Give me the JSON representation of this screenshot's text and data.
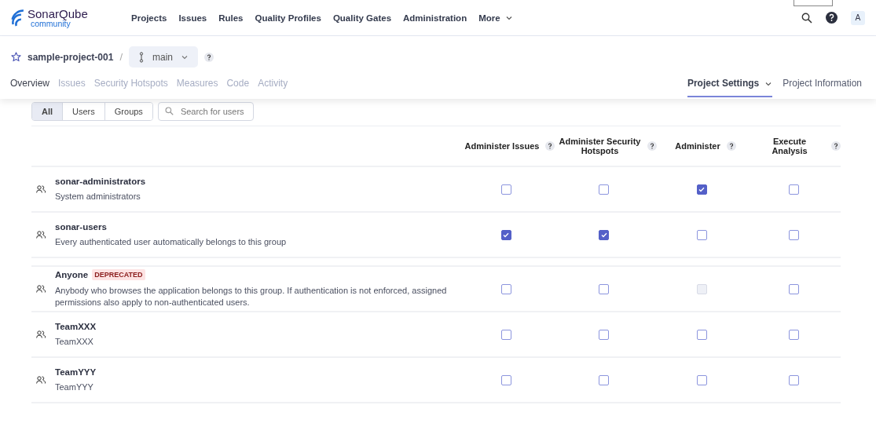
{
  "logo": {
    "name": "SonarQube",
    "edition": "community"
  },
  "nav": [
    {
      "label": "Projects"
    },
    {
      "label": "Issues"
    },
    {
      "label": "Rules"
    },
    {
      "label": "Quality Profiles"
    },
    {
      "label": "Quality Gates"
    },
    {
      "label": "Administration"
    },
    {
      "label": "More",
      "kind": "menu"
    }
  ],
  "user": {
    "initial": "A"
  },
  "breadcrumb": {
    "project": "sample-project-001",
    "separator": "/",
    "branch": "main"
  },
  "project_tabs": [
    {
      "label": "Overview",
      "disabled": false
    },
    {
      "label": "Issues",
      "disabled": true
    },
    {
      "label": "Security Hotspots",
      "disabled": true
    },
    {
      "label": "Measures",
      "disabled": true
    },
    {
      "label": "Code",
      "disabled": true
    },
    {
      "label": "Activity",
      "disabled": true
    }
  ],
  "project_menus": [
    {
      "label": "Project Settings",
      "selected": true,
      "kind": "menu"
    },
    {
      "label": "Project Information",
      "selected": false,
      "kind": "link"
    }
  ],
  "filter": {
    "options": [
      {
        "label": "All",
        "selected": true
      },
      {
        "label": "Users",
        "selected": false
      },
      {
        "label": "Groups",
        "selected": false
      }
    ],
    "search": {
      "placeholder": "Search for users"
    }
  },
  "table": {
    "columns": [
      "Administer Issues",
      "Administer Security Hotspots",
      "Administer",
      "Execute Analysis"
    ],
    "rows": [
      {
        "name": "sonar-administrators",
        "description": "System administrators",
        "permissions": [
          {
            "checked": false,
            "disabled": false
          },
          {
            "checked": false,
            "disabled": false
          },
          {
            "checked": true,
            "disabled": false
          },
          {
            "checked": false,
            "disabled": false
          }
        ]
      },
      {
        "name": "sonar-users",
        "description": "Every authenticated user automatically belongs to this group",
        "permissions": [
          {
            "checked": true,
            "disabled": false
          },
          {
            "checked": true,
            "disabled": false
          },
          {
            "checked": false,
            "disabled": false
          },
          {
            "checked": false,
            "disabled": false
          }
        ]
      },
      {
        "name": "Anyone",
        "badge": "DEPRECATED",
        "separated": true,
        "description": "Anybody who browses the application belongs to this group. If authentication is not enforced, assigned permissions also apply to non-authenticated users.",
        "permissions": [
          {
            "checked": false,
            "disabled": false
          },
          {
            "checked": false,
            "disabled": false
          },
          {
            "checked": false,
            "disabled": true
          },
          {
            "checked": false,
            "disabled": false
          }
        ]
      },
      {
        "name": "TeamXXX",
        "description": "TeamXXX",
        "permissions": [
          {
            "checked": false,
            "disabled": false
          },
          {
            "checked": false,
            "disabled": false
          },
          {
            "checked": false,
            "disabled": false
          },
          {
            "checked": false,
            "disabled": false
          }
        ]
      },
      {
        "name": "TeamYYY",
        "description": "TeamYYY",
        "permissions": [
          {
            "checked": false,
            "disabled": false
          },
          {
            "checked": false,
            "disabled": false
          },
          {
            "checked": false,
            "disabled": false
          },
          {
            "checked": false,
            "disabled": false
          }
        ]
      }
    ]
  }
}
